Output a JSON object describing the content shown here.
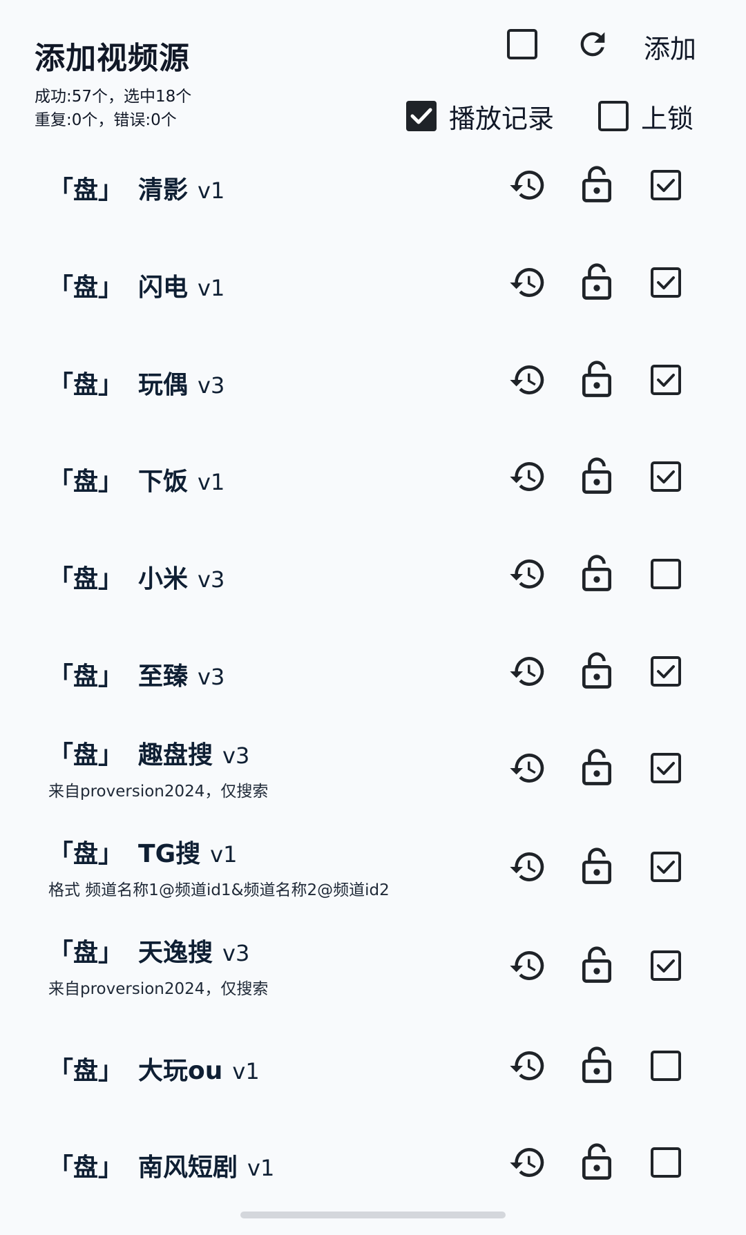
{
  "header": {
    "title": "添加视频源",
    "stats_line1": "成功:57个，选中18个",
    "stats_line2": "重复:0个，错误:0个",
    "add_label": "添加",
    "select_all_checked": false,
    "play_record": {
      "label": "播放记录",
      "checked": true
    },
    "lock": {
      "label": "上锁",
      "checked": false
    }
  },
  "icons": {
    "select_all": "checkbox-empty-icon",
    "refresh": "refresh-icon",
    "history": "history-icon",
    "lock": "lock-open-icon",
    "checkbox_checked": "checkbox-checked-icon",
    "checkbox_empty": "checkbox-empty-icon"
  },
  "colors": {
    "background": "#f8fafc",
    "text": "#111827",
    "title_text": "#0f1f33",
    "icon": "#1f2328"
  },
  "sources": [
    {
      "prefix": "「盘」",
      "name": "清影",
      "version": "v1",
      "subtitle": "",
      "checked": true
    },
    {
      "prefix": "「盘」",
      "name": "闪电",
      "version": "v1",
      "subtitle": "",
      "checked": true
    },
    {
      "prefix": "「盘」",
      "name": "玩偶",
      "version": "v3",
      "subtitle": "",
      "checked": true
    },
    {
      "prefix": "「盘」",
      "name": "下饭",
      "version": "v1",
      "subtitle": "",
      "checked": true
    },
    {
      "prefix": "「盘」",
      "name": "小米",
      "version": "v3",
      "subtitle": "",
      "checked": false
    },
    {
      "prefix": "「盘」",
      "name": "至臻",
      "version": "v3",
      "subtitle": "",
      "checked": true
    },
    {
      "prefix": "「盘」",
      "name": "趣盘搜",
      "version": "v3",
      "subtitle": "来自proversion2024，仅搜索",
      "checked": true
    },
    {
      "prefix": "「盘」",
      "name": "TG搜",
      "version": "v1",
      "subtitle": "格式 频道名称1@频道id1&频道名称2@频道id2",
      "checked": true
    },
    {
      "prefix": "「盘」",
      "name": "天逸搜",
      "version": "v3",
      "subtitle": "来自proversion2024，仅搜索",
      "checked": true
    },
    {
      "prefix": "「盘」",
      "name": "大玩ou",
      "version": "v1",
      "subtitle": "",
      "checked": false
    },
    {
      "prefix": "「盘」",
      "name": "南风短剧",
      "version": "v1",
      "subtitle": "",
      "checked": false
    }
  ]
}
